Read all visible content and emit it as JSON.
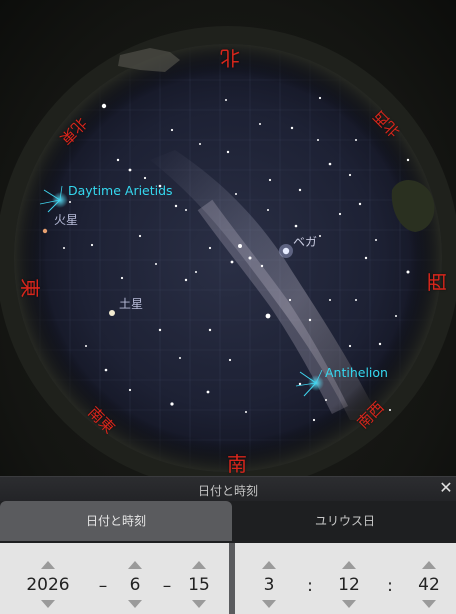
{
  "sky": {
    "cardinals": {
      "north": "北",
      "south": "南",
      "east": "東",
      "west": "西",
      "northeast": "北東",
      "northwest": "北西",
      "southeast": "南東",
      "southwest": "南西"
    },
    "labels": {
      "daytime_arietids": "Daytime Arietids",
      "mars": "火星",
      "saturn": "土星",
      "vega": "ベガ",
      "antihelion": "Antihelion"
    },
    "colors": {
      "cardinal": "#d7261c",
      "meteor_label": "#35d8ef"
    }
  },
  "dialog": {
    "title": "日付と時刻",
    "close_icon": "close-icon",
    "tabs": {
      "date_time": "日付と時刻",
      "julian_day": "ユリウス日"
    },
    "date": {
      "year": "2026",
      "month": "6",
      "day": "15",
      "sep1": "–",
      "sep2": "–"
    },
    "time": {
      "hour": "3",
      "minute": "12",
      "second": "42",
      "sep1": ":",
      "sep2": ":"
    }
  }
}
